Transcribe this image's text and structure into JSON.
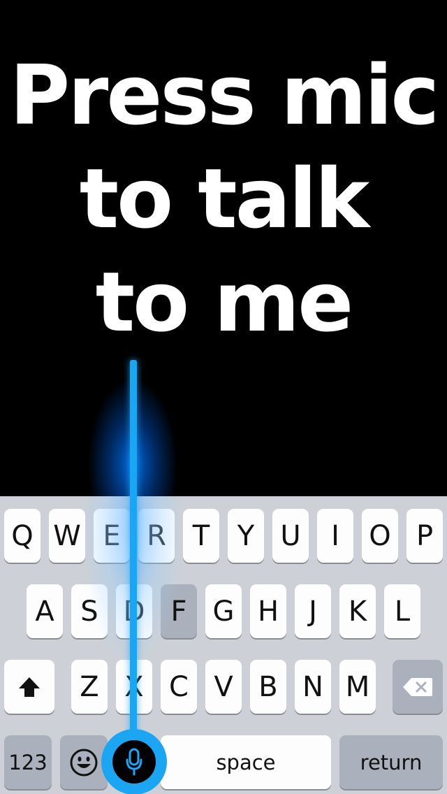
{
  "headline": {
    "line1": "Press mic",
    "line2": "to talk",
    "line3": "to me"
  },
  "keyboard": {
    "row1": [
      "Q",
      "W",
      "E",
      "R",
      "T",
      "Y",
      "U",
      "I",
      "O",
      "P"
    ],
    "row2": [
      "A",
      "S",
      "D",
      "F",
      "G",
      "H",
      "J",
      "K",
      "L"
    ],
    "row3": [
      "Z",
      "X",
      "C",
      "V",
      "B",
      "N",
      "M"
    ],
    "numbers_label": "123",
    "space_label": "space",
    "return_label": "return",
    "shift_icon": "shift-arrow-icon",
    "delete_icon": "delete-backspace-icon",
    "emoji_icon": "emoji-face-icon",
    "mic_icon": "microphone-icon"
  },
  "colors": {
    "accent": "#1aa6f2",
    "keyboard_bg": "#cdd1d7",
    "key_bg": "#fdfdfe",
    "dark_key_bg": "#aab1bc"
  }
}
